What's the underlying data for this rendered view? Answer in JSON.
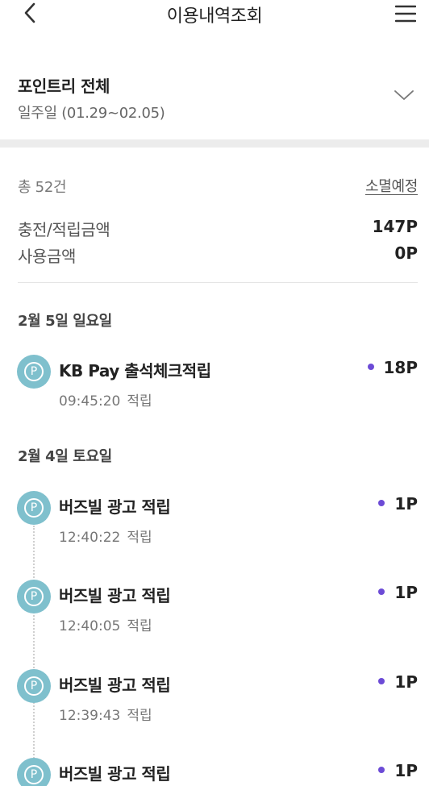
{
  "header": {
    "title": "이용내역조회",
    "back_icon": "chevron-left-icon",
    "menu_icon": "hamburger-menu-icon"
  },
  "filter": {
    "title": "포인트리 전체",
    "period": "일주일 (01.29~02.05)",
    "expand_icon": "chevron-down-icon"
  },
  "summary": {
    "total_count": "총 52건",
    "expire_link": "소멸예정",
    "charge_label": "충전/적립금액",
    "charge_value": "147P",
    "usage_label": "사용금액",
    "usage_value": "0P"
  },
  "groups": [
    {
      "date": "2월 5일 일요일",
      "items": [
        {
          "title": "KB Pay 출석체크적립",
          "time": "09:45:20",
          "type": "적립",
          "amount": "18P"
        }
      ]
    },
    {
      "date": "2월 4일 토요일",
      "items": [
        {
          "title": "버즈빌 광고 적립",
          "time": "12:40:22",
          "type": "적립",
          "amount": "1P"
        },
        {
          "title": "버즈빌 광고 적립",
          "time": "12:40:05",
          "type": "적립",
          "amount": "1P"
        },
        {
          "title": "버즈빌 광고 적립",
          "time": "12:39:43",
          "type": "적립",
          "amount": "1P"
        },
        {
          "title": "버즈빌 광고 적립",
          "time": "",
          "type": "",
          "amount": "1P"
        }
      ]
    }
  ],
  "colors": {
    "icon_bg": "#7fc0cd",
    "accent_dot": "#6c4bd6",
    "divider": "#ececec"
  }
}
